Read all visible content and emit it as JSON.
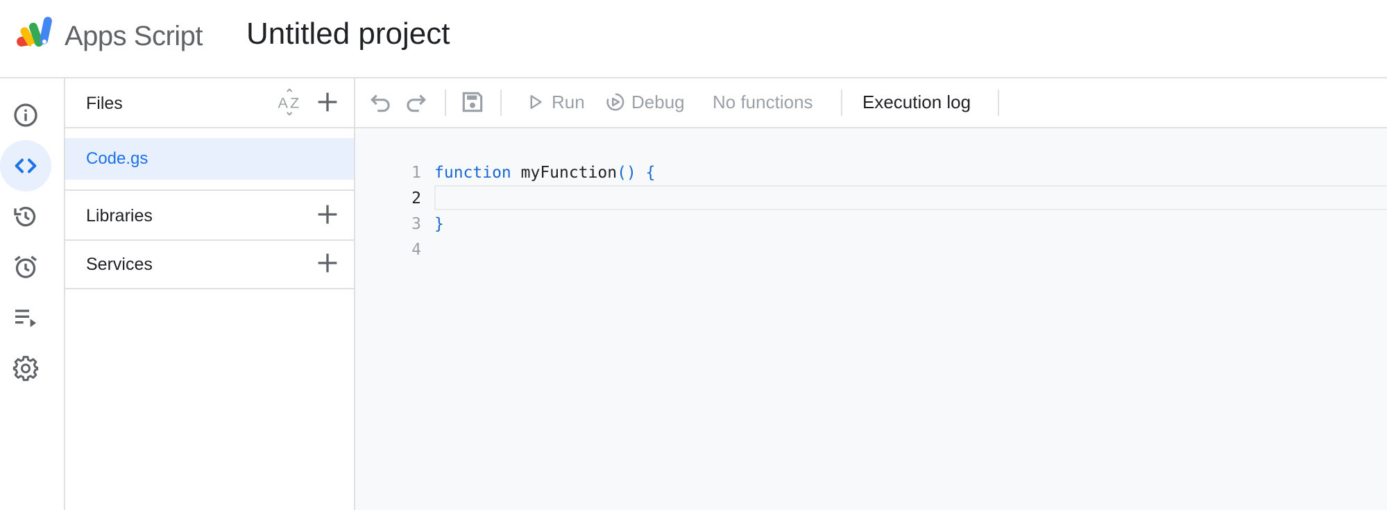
{
  "header": {
    "app_name": "Apps Script",
    "project_title": "Untitled project"
  },
  "rail": {
    "items": [
      {
        "icon": "info-icon",
        "active": false
      },
      {
        "icon": "code-icon",
        "active": true
      },
      {
        "icon": "history-icon",
        "active": false
      },
      {
        "icon": "alarm-icon",
        "active": false
      },
      {
        "icon": "executions-icon",
        "active": false
      },
      {
        "icon": "gear-icon",
        "active": false
      }
    ]
  },
  "files_panel": {
    "files_label": "Files",
    "files": [
      "Code.gs"
    ],
    "libraries_label": "Libraries",
    "services_label": "Services"
  },
  "toolbar": {
    "run_label": "Run",
    "debug_label": "Debug",
    "function_select": "No functions",
    "execution_log_label": "Execution log"
  },
  "editor": {
    "line_numbers": [
      "1",
      "2",
      "3",
      "4"
    ],
    "current_line": "2",
    "lines": [
      {
        "keyword": "function",
        "name": " myFunction",
        "parens": "()",
        "brace": " {"
      },
      "",
      "}",
      ""
    ]
  },
  "colors": {
    "accent": "#1a73e8",
    "active_bg": "#e8f0fe",
    "editor_bg": "#f8f9fa",
    "border": "#e0e0e0"
  }
}
